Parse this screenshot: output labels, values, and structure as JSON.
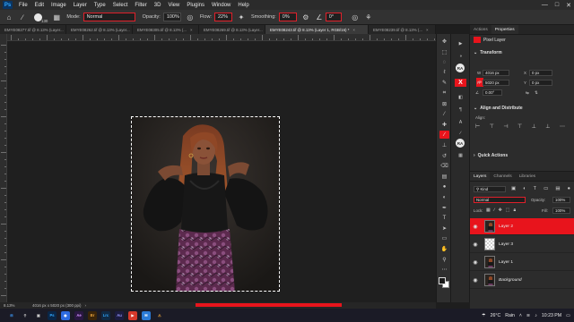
{
  "menubar": {
    "logo": "Ps",
    "items": [
      "File",
      "Edit",
      "Image",
      "Layer",
      "Type",
      "Select",
      "Filter",
      "3D",
      "View",
      "Plugins",
      "Window",
      "Help"
    ],
    "controls": [
      "—",
      "□",
      "✕"
    ]
  },
  "options": {
    "brush_size": "130",
    "mode_label": "Mode:",
    "mode_value": "Normal",
    "opacity_label": "Opacity:",
    "opacity_value": "100%",
    "flow_label": "Flow:",
    "flow_value": "22%",
    "smoothing_label": "Smoothing:",
    "smoothing_value": "0%",
    "angle_value": "0°"
  },
  "tabs": [
    {
      "label": "EMYE08277.tif @ 8.13% (Layer...",
      "active": false
    },
    {
      "label": "EMYE08262.tif @ 8.13% (Layer...",
      "active": false
    },
    {
      "label": "EMYE08305.tif @ 8.13% (...",
      "active": false
    },
    {
      "label": "EMYE08269.tif @ 8.13% (Layer...",
      "active": false
    },
    {
      "label": "EMYE08243.tif @ 8.13% (Layer 1, RGB/16) *",
      "active": true
    },
    {
      "label": "EMYE08239.tif @ 8.13% (...",
      "active": false
    }
  ],
  "status": {
    "zoom": "8.13%",
    "doc_info": "4016 px x 5020 px (300 ppi)"
  },
  "toolbar": {
    "tools": [
      {
        "name": "move-tool-icon",
        "glyph": "✥"
      },
      {
        "name": "artboard-tool-icon",
        "glyph": "⬚"
      },
      {
        "name": "marquee-tool-icon",
        "glyph": "◌"
      },
      {
        "name": "lasso-tool-icon",
        "glyph": "ℓ"
      },
      {
        "name": "quick-select-tool-icon",
        "glyph": "✎"
      },
      {
        "name": "crop-tool-icon",
        "glyph": "⌗"
      },
      {
        "name": "frame-tool-icon",
        "glyph": "⊠"
      },
      {
        "name": "eyedropper-tool-icon",
        "glyph": "⁄"
      },
      {
        "name": "healing-brush-tool-icon",
        "glyph": "✚"
      },
      {
        "name": "brush-tool-icon",
        "glyph": "∕",
        "active": true
      },
      {
        "name": "clone-stamp-tool-icon",
        "glyph": "⊥"
      },
      {
        "name": "history-brush-tool-icon",
        "glyph": "↺"
      },
      {
        "name": "eraser-tool-icon",
        "glyph": "⌫"
      },
      {
        "name": "gradient-tool-icon",
        "glyph": "▤"
      },
      {
        "name": "blur-tool-icon",
        "glyph": "●"
      },
      {
        "name": "dodge-tool-icon",
        "glyph": "◐"
      },
      {
        "name": "pen-tool-icon",
        "glyph": "✒"
      },
      {
        "name": "type-tool-icon",
        "glyph": "T"
      },
      {
        "name": "path-select-tool-icon",
        "glyph": "➤"
      },
      {
        "name": "rectangle-tool-icon",
        "glyph": "▭"
      },
      {
        "name": "hand-tool-icon",
        "glyph": "✋"
      },
      {
        "name": "zoom-tool-icon",
        "glyph": "⚲"
      },
      {
        "name": "more-tools-icon",
        "glyph": "⋯"
      }
    ]
  },
  "strip": {
    "ra_1": "RA",
    "ra_2": "RA",
    "x_label": "X"
  },
  "properties": {
    "tab_actions": "Actions",
    "tab_properties": "Properties",
    "pixel_layer": "Pixel Layer",
    "transform_title": "Transform",
    "w_label": "W",
    "w_value": "4016 px",
    "h_label": "H",
    "h_value": "5020 px",
    "x_label": "X",
    "x_value": "0 px",
    "y_label": "Y",
    "y_value": "0 px",
    "angle_value": "0.00°",
    "align_title": "Align and Distribute",
    "align_label": "Align:",
    "quick_actions": "Quick Actions"
  },
  "layers_panel": {
    "tab_layers": "Layers",
    "tab_channels": "Channels",
    "tab_libraries": "Libraries",
    "kind": "Kind",
    "blend_mode": "Normal",
    "opacity_label": "Opacity:",
    "opacity_value": "100%",
    "lock_label": "Lock:",
    "fill_label": "Fill:",
    "fill_value": "100%",
    "layers": [
      {
        "name": "Layer 2",
        "selected": true,
        "thumb": "photo"
      },
      {
        "name": "Layer 3",
        "selected": false,
        "thumb": "checker"
      },
      {
        "name": "Layer 1",
        "selected": false,
        "thumb": "photo"
      },
      {
        "name": "Background",
        "selected": false,
        "thumb": "photo",
        "italic": true
      }
    ]
  },
  "taskbar": {
    "apps": [
      {
        "label": "⊞",
        "color": "#3a8ee6",
        "bg": "#1b1b26"
      },
      {
        "label": "⚲",
        "color": "#cccccc",
        "bg": "#1b1b26"
      },
      {
        "label": "▣",
        "color": "#cccccc",
        "bg": "#1b1b26"
      },
      {
        "label": "Ps",
        "color": "#31a8ff",
        "bg": "#0a2647"
      },
      {
        "label": "◉",
        "color": "#ffffff",
        "bg": "#2d6be0"
      },
      {
        "label": "Ae",
        "color": "#d291ff",
        "bg": "#2a1742"
      },
      {
        "label": "Br",
        "color": "#e8a33d",
        "bg": "#3b2509"
      },
      {
        "label": "Lrc",
        "color": "#31a8ff",
        "bg": "#102a44"
      },
      {
        "label": "Au",
        "color": "#9999ff",
        "bg": "#1c1c40"
      },
      {
        "label": "▶",
        "color": "#ffffff",
        "bg": "#d6392b"
      },
      {
        "label": "✉",
        "color": "#ffffff",
        "bg": "#2b7bd6"
      },
      {
        "label": "⚠",
        "color": "#f0a83a",
        "bg": "#1b1b26"
      }
    ],
    "weather_temp": "26°C",
    "weather_text": "Rain",
    "time": "10:23 PM"
  },
  "colors": {
    "accent": "#e8141c",
    "panel_bg": "#2c2c2c",
    "canvas_bg": "#1f1f1f"
  }
}
